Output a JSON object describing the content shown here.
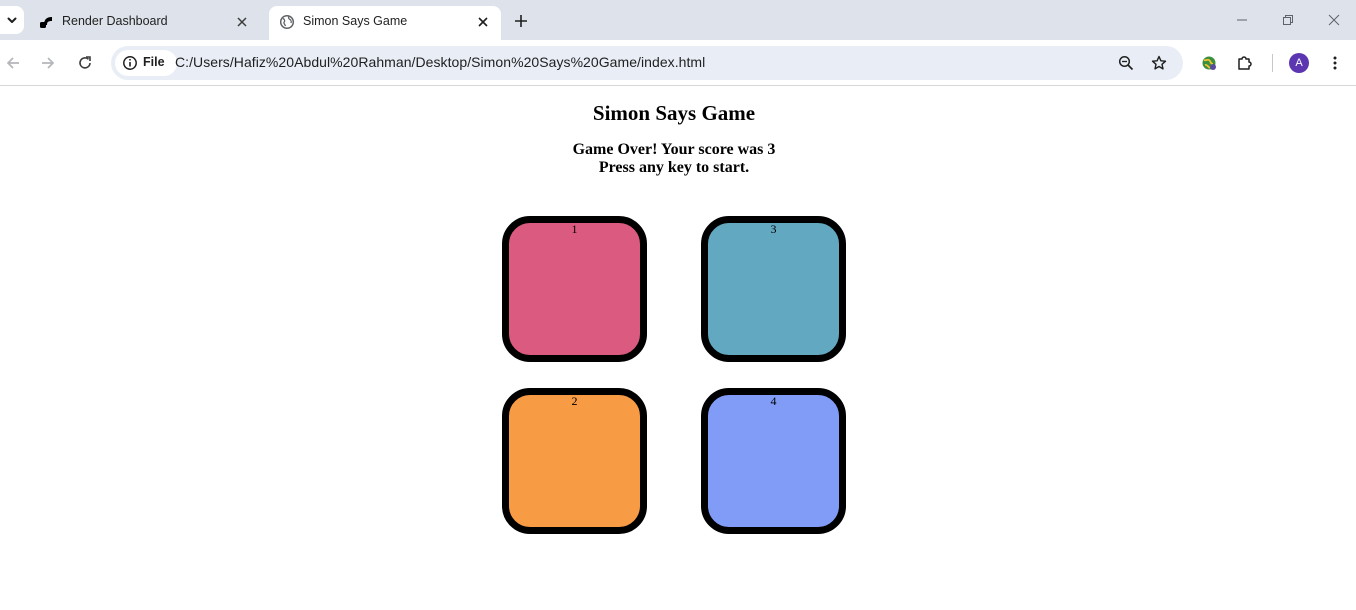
{
  "browser": {
    "tabs": [
      {
        "title": "Render Dashboard",
        "active": false,
        "favicon": "render-logo-icon"
      },
      {
        "title": "Simon Says Game",
        "active": true,
        "favicon": "globe-icon"
      }
    ],
    "address": {
      "chip_label": "File",
      "url": "C:/Users/Hafiz%20Abdul%20Rahman/Desktop/Simon%20Says%20Game/index.html"
    },
    "profile_initial": "A",
    "accent_color": "#5b36b0"
  },
  "game": {
    "title": "Simon Says Game",
    "status_line1": "Game Over! Your score was 3",
    "status_line2": "Press any key to start.",
    "buttons": [
      {
        "label": "1",
        "color": "#db5a7f"
      },
      {
        "label": "3",
        "color": "#62a8c0"
      },
      {
        "label": "2",
        "color": "#f79b45"
      },
      {
        "label": "4",
        "color": "#819cf7"
      }
    ]
  }
}
